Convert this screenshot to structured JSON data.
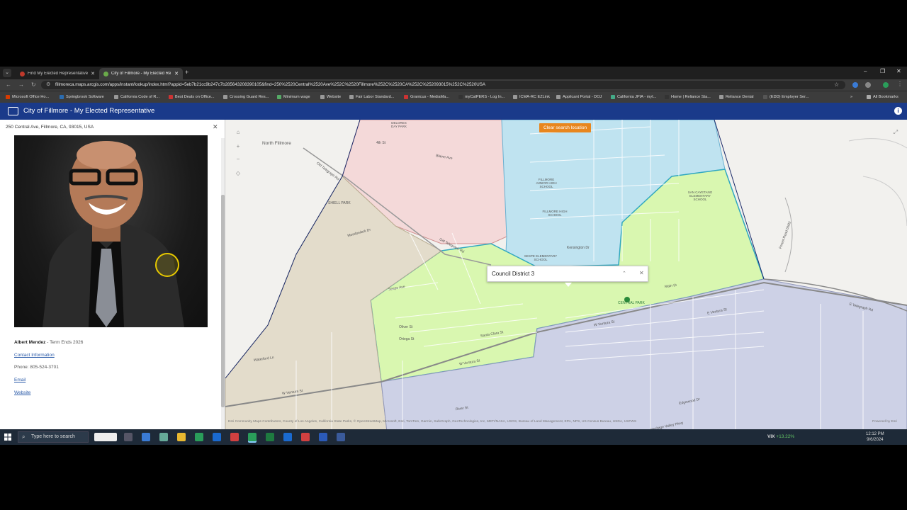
{
  "browser": {
    "tabs": [
      {
        "title": "Find My Elected Representatives",
        "favicon_color": "#c0392b",
        "active": false
      },
      {
        "title": "City of Fillmore - My Elected Re",
        "favicon_color": "#6aaa4a",
        "active": true
      }
    ],
    "new_tab": "+",
    "window_controls": {
      "minimize": "–",
      "maximize": "❐",
      "close": "✕"
    },
    "url": "fillmoreca.maps.arcgis.com/apps/instant/lookup/index.html?appid=5eb7b21cc9b247c7b285643208390105&find=250%2520Central%2520Ave%252C%2520Fillmore%252C%2520CA%252C%252093015%252C%2520USA",
    "bookmarks": [
      "Microsoft Office Ho...",
      "Springbrook Software",
      "California Code of R...",
      "Best Deals on Office...",
      "Crossing Guard Res...",
      "Minimum wage",
      "Website",
      "Fair Labor Standard...",
      "Granicus - MediaMa...",
      "myCalPERS - Log In...",
      "ICMA-RC EZLink",
      "Applicant Portal - DOJ",
      "California JPIA - myI...",
      "Home | Reliance Sta...",
      "Reliance Dental",
      "(EDD) Employer Ser..."
    ],
    "all_bookmarks": "All Bookmarks"
  },
  "app": {
    "title": "City of Fillmore - My Elected Representative",
    "colors": {
      "header": "#1a3a8a",
      "accent": "#e8861e"
    }
  },
  "panel": {
    "address": "250 Central Ave, Fillmore, CA, 93015, USA",
    "representative": {
      "name": "Albert Mendez",
      "term": " - Term Ends 2026",
      "contact_label": "Contact Information",
      "phone": "Phone: 805-524-3701",
      "email_label": "Email",
      "website_label": "Website"
    }
  },
  "map": {
    "clear_button": "Clear search location",
    "popup_title": "Council District 3",
    "labels": {
      "north_fillmore": "North Fillmore",
      "old_telegraph": "Old Telegraph Rd",
      "shiell_park": "SHIELL PARK",
      "meadowlark": "Meadowlark Dr",
      "sespe_ave": "Sespe Ave",
      "ventura_st": "W Ventura St",
      "e_ventura": "E Ventura St",
      "e_telegraph": "E Telegraph Rd",
      "main_st": "Main St",
      "central_park": "CENTRAL PARK",
      "fillmore_jhs": "FILLMORE JUNIOR HIGH SCHOOL",
      "fillmore_hs": "FILLMORE HIGH SCHOOL",
      "sespe_es": "SESPE ELEMENTARY SCHOOL",
      "san_cayetano": "SAN CAYETANO ELEMENTARY SCHOOL",
      "river_st": "River St",
      "waterford": "Waterford Ln",
      "oliver_st": "Oliver St",
      "ortega_st": "Ortega St",
      "santa_clara": "Santa Clara St",
      "kensington": "Kensington Dr",
      "delores": "DELORES DAY PARK",
      "fourth_st": "4th St",
      "blaine": "Blaine Ave",
      "heritage": "Heritage Valley Pkwy",
      "edgewood": "Edgewood Dr",
      "forest_road": "Forest Road 6N02"
    },
    "attribution": "Esri Community Maps Contributors, County of Los Angeles, California State Parks, © OpenStreetMap, Microsoft, Esri, TomTom, Garmin, SafeGraph, GeoTechnologies, Inc, METI/NASA, USGS, Bureau of Land Management, EPA, NPS, US Census Bureau, USDA, USFWS",
    "powered_by": "Powered by Esri",
    "district_colors": {
      "district_1": "#f4d9d9",
      "district_2": "#bfe3f0",
      "district_3": "#d9f7b0",
      "district_4": "#e3dccb",
      "district_5": "#cdd1e6"
    }
  },
  "taskbar": {
    "search_placeholder": "Type here to search",
    "vix_label": "VIX",
    "vix_change": "+13.22%",
    "time": "12:12 PM",
    "date": "9/6/2024"
  }
}
